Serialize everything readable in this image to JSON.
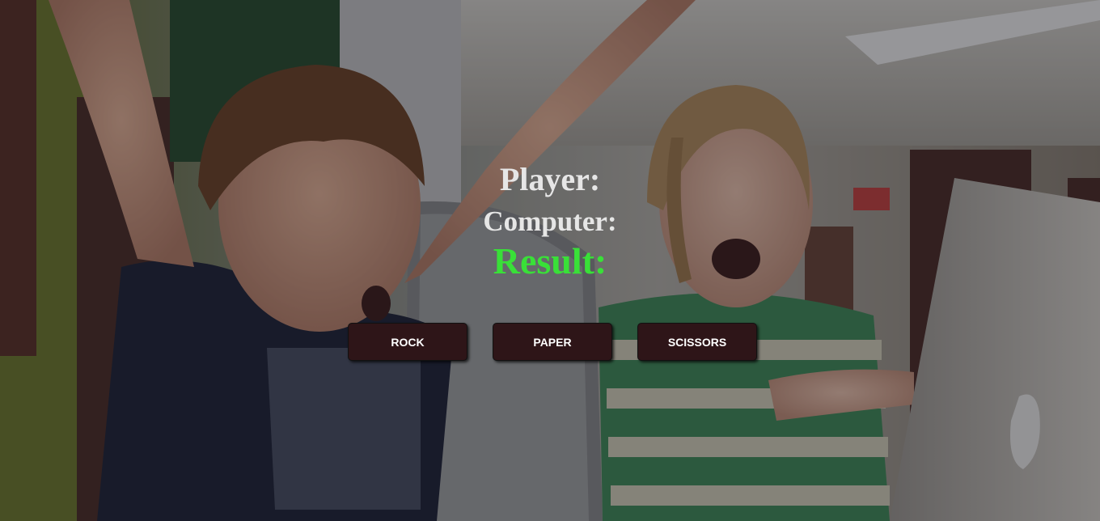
{
  "scoreboard": {
    "player_label": "Player:",
    "computer_label": "Computer:",
    "result_label": "Result:"
  },
  "buttons": {
    "rock": "ROCK",
    "paper": "PAPER",
    "scissors": "SCISSORS"
  },
  "colors": {
    "text": "#e6e6e6",
    "result": "#39e038",
    "button_bg": "#2e1518",
    "button_text": "#ffffff"
  }
}
